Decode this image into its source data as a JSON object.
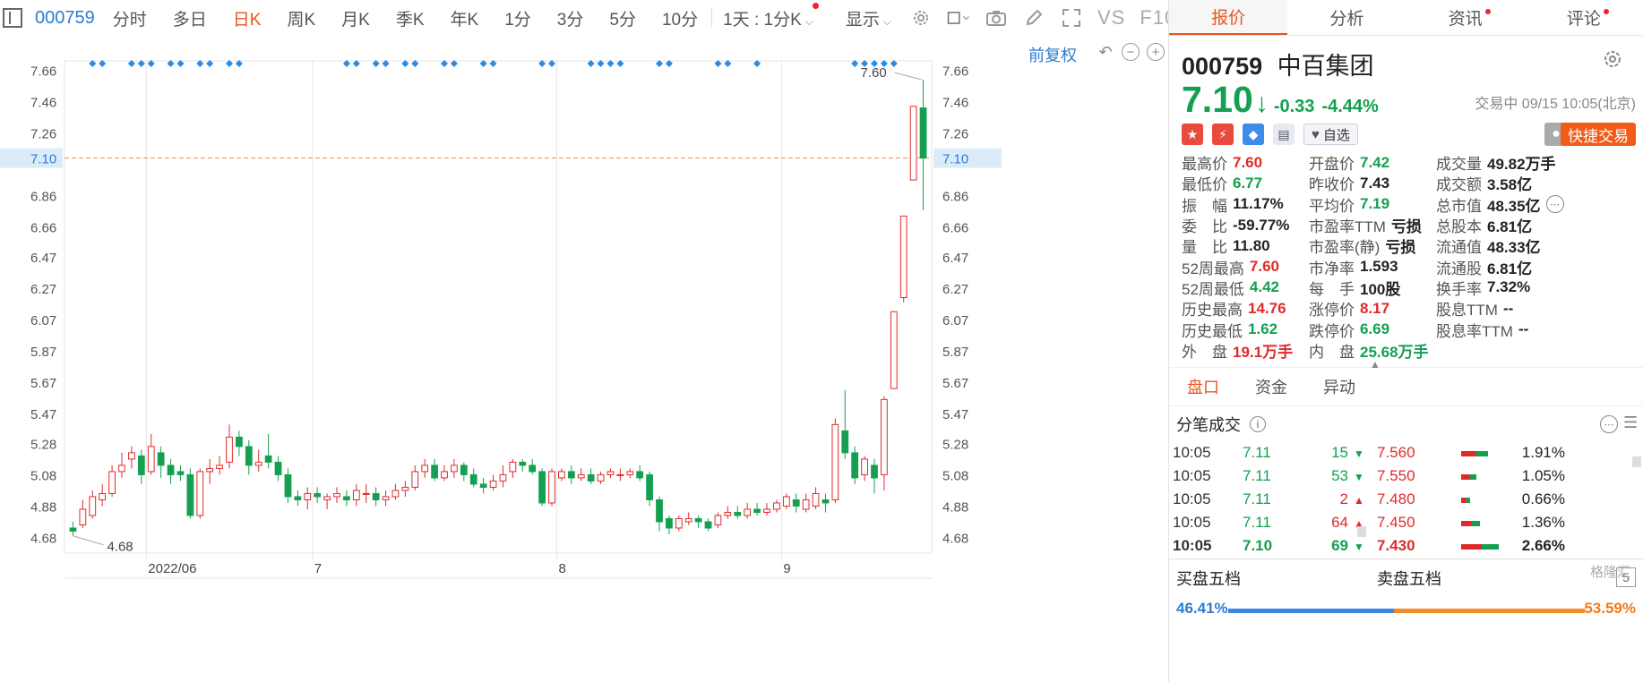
{
  "toolbar": {
    "code": "000759",
    "periods": [
      "分时",
      "多日",
      "日K",
      "周K",
      "月K",
      "季K",
      "年K",
      "1分",
      "3分",
      "5分",
      "10分"
    ],
    "active_period": "日K",
    "interval_select": "1天 : 1分K",
    "display_label": "显示",
    "vs_label": "VS",
    "f10_label": "F10"
  },
  "chart": {
    "adjust_label": "前复权",
    "y_ticks": [
      "7.66",
      "7.46",
      "7.26",
      "7.10",
      "6.86",
      "6.66",
      "6.47",
      "6.27",
      "6.07",
      "5.87",
      "5.67",
      "5.47",
      "5.28",
      "5.08",
      "4.88",
      "4.68"
    ],
    "current_price_label": "7.10",
    "high_label": "7.60",
    "low_label": "4.68",
    "x_labels": [
      "2022/06",
      "7",
      "8",
      "9"
    ],
    "up_color": "#e02a2a",
    "down_color": "#14a050"
  },
  "chart_data": {
    "type": "candlestick",
    "ylim": [
      4.58,
      7.72
    ],
    "current_price": 7.1,
    "high_marker": 7.6,
    "low_marker": 4.68,
    "month_boundaries": [
      {
        "label": "2022/06",
        "index": 8
      },
      {
        "label": "7",
        "index": 25
      },
      {
        "label": "8",
        "index": 50
      },
      {
        "label": "9",
        "index": 73
      }
    ],
    "event_marker_indices": [
      2,
      3,
      6,
      7,
      8,
      10,
      11,
      13,
      14,
      16,
      17,
      28,
      29,
      31,
      32,
      34,
      35,
      38,
      39,
      42,
      43,
      48,
      49,
      53,
      54,
      55,
      56,
      60,
      61,
      66,
      67,
      70,
      80,
      81,
      82,
      83,
      84
    ],
    "ohlc": [
      [
        4.74,
        4.72,
        4.78,
        4.69
      ],
      [
        4.76,
        4.86,
        4.92,
        4.74
      ],
      [
        4.82,
        4.94,
        4.98,
        4.8
      ],
      [
        4.92,
        4.96,
        5.02,
        4.88
      ],
      [
        4.96,
        5.1,
        5.14,
        4.94
      ],
      [
        5.1,
        5.14,
        5.22,
        5.06
      ],
      [
        5.18,
        5.22,
        5.26,
        5.12
      ],
      [
        5.2,
        5.08,
        5.24,
        5.02
      ],
      [
        5.1,
        5.26,
        5.34,
        5.08
      ],
      [
        5.22,
        5.14,
        5.26,
        5.06
      ],
      [
        5.14,
        5.08,
        5.18,
        5.02
      ],
      [
        5.1,
        5.08,
        5.14,
        5.04
      ],
      [
        5.08,
        4.82,
        5.12,
        4.8
      ],
      [
        4.82,
        5.1,
        5.12,
        4.8
      ],
      [
        5.1,
        5.12,
        5.18,
        5.02
      ],
      [
        5.12,
        5.14,
        5.2,
        5.08
      ],
      [
        5.16,
        5.32,
        5.4,
        5.12
      ],
      [
        5.32,
        5.26,
        5.36,
        5.2
      ],
      [
        5.26,
        5.14,
        5.3,
        5.08
      ],
      [
        5.14,
        5.16,
        5.24,
        5.1
      ],
      [
        5.2,
        5.16,
        5.34,
        5.12
      ],
      [
        5.16,
        5.08,
        5.2,
        5.04
      ],
      [
        5.08,
        4.94,
        5.12,
        4.9
      ],
      [
        4.94,
        4.92,
        4.98,
        4.88
      ],
      [
        4.92,
        4.96,
        5.0,
        4.86
      ],
      [
        4.96,
        4.94,
        5.0,
        4.9
      ],
      [
        4.92,
        4.94,
        4.96,
        4.86
      ],
      [
        4.94,
        4.96,
        5.0,
        4.9
      ],
      [
        4.94,
        4.92,
        4.98,
        4.88
      ],
      [
        4.92,
        4.98,
        5.02,
        4.88
      ],
      [
        4.96,
        4.96,
        5.02,
        4.9
      ],
      [
        4.96,
        4.92,
        5.0,
        4.88
      ],
      [
        4.92,
        4.94,
        4.98,
        4.88
      ],
      [
        4.94,
        4.98,
        5.02,
        4.92
      ],
      [
        4.98,
        5.0,
        5.04,
        4.94
      ],
      [
        5.0,
        5.1,
        5.14,
        4.98
      ],
      [
        5.1,
        5.14,
        5.18,
        5.06
      ],
      [
        5.14,
        5.06,
        5.18,
        5.04
      ],
      [
        5.06,
        5.1,
        5.14,
        5.04
      ],
      [
        5.1,
        5.14,
        5.18,
        5.06
      ],
      [
        5.14,
        5.08,
        5.16,
        5.04
      ],
      [
        5.08,
        5.02,
        5.12,
        5.0
      ],
      [
        5.02,
        5.0,
        5.06,
        4.96
      ],
      [
        5.0,
        5.04,
        5.08,
        4.98
      ],
      [
        5.04,
        5.08,
        5.14,
        5.0
      ],
      [
        5.1,
        5.16,
        5.18,
        5.06
      ],
      [
        5.16,
        5.14,
        5.18,
        5.1
      ],
      [
        5.14,
        5.1,
        5.18,
        5.08
      ],
      [
        5.1,
        4.9,
        5.12,
        4.88
      ],
      [
        4.9,
        5.1,
        5.12,
        4.88
      ],
      [
        5.06,
        5.1,
        5.12,
        5.04
      ],
      [
        5.1,
        5.06,
        5.14,
        5.02
      ],
      [
        5.06,
        5.08,
        5.12,
        5.04
      ],
      [
        5.08,
        5.04,
        5.12,
        5.02
      ],
      [
        5.04,
        5.08,
        5.1,
        5.02
      ],
      [
        5.08,
        5.1,
        5.12,
        5.06
      ],
      [
        5.08,
        5.08,
        5.12,
        5.04
      ],
      [
        5.08,
        5.1,
        5.12,
        5.06
      ],
      [
        5.1,
        5.06,
        5.14,
        5.04
      ],
      [
        5.08,
        4.92,
        5.1,
        4.88
      ],
      [
        4.92,
        4.78,
        4.94,
        4.72
      ],
      [
        4.8,
        4.74,
        4.82,
        4.7
      ],
      [
        4.74,
        4.8,
        4.82,
        4.72
      ],
      [
        4.78,
        4.8,
        4.84,
        4.76
      ],
      [
        4.8,
        4.78,
        4.82,
        4.74
      ],
      [
        4.78,
        4.74,
        4.8,
        4.72
      ],
      [
        4.76,
        4.82,
        4.84,
        4.74
      ],
      [
        4.82,
        4.84,
        4.88,
        4.8
      ],
      [
        4.84,
        4.82,
        4.88,
        4.8
      ],
      [
        4.82,
        4.86,
        4.9,
        4.8
      ],
      [
        4.86,
        4.84,
        4.9,
        4.82
      ],
      [
        4.84,
        4.86,
        4.9,
        4.82
      ],
      [
        4.86,
        4.9,
        4.92,
        4.84
      ],
      [
        4.88,
        4.94,
        4.96,
        4.86
      ],
      [
        4.92,
        4.88,
        4.96,
        4.84
      ],
      [
        4.86,
        4.92,
        4.96,
        4.84
      ],
      [
        4.88,
        4.96,
        5.0,
        4.86
      ],
      [
        4.92,
        4.9,
        4.96,
        4.84
      ],
      [
        4.92,
        5.4,
        5.44,
        4.9
      ],
      [
        5.36,
        5.22,
        5.62,
        5.18
      ],
      [
        5.22,
        5.06,
        5.26,
        5.02
      ],
      [
        5.08,
        5.18,
        5.2,
        5.04
      ],
      [
        5.14,
        5.06,
        5.18,
        4.96
      ],
      [
        5.08,
        5.56,
        5.58,
        4.98
      ],
      [
        5.63,
        6.12,
        6.12,
        5.63
      ],
      [
        6.21,
        6.73,
        6.73,
        6.18
      ],
      [
        6.96,
        7.43,
        7.43,
        6.96
      ],
      [
        7.42,
        7.1,
        7.6,
        6.77
      ]
    ]
  },
  "panel": {
    "tabs": [
      "报价",
      "分析",
      "资讯",
      "评论"
    ],
    "active_tab": "报价",
    "code": "000759",
    "name": "中百集团",
    "price": "7.10",
    "change": "-0.33",
    "change_pct": "-4.44%",
    "status": "交易中 09/15 10:05(北京)",
    "favorite_label": "自选",
    "quick_trade_label": "快捷交易",
    "quote": {
      "col1": [
        {
          "label": "最高价",
          "value": "7.60",
          "tone": "red"
        },
        {
          "label": "最低价",
          "value": "6.77",
          "tone": "green"
        },
        {
          "label": "振　幅",
          "value": "11.17%",
          "tone": "dark"
        },
        {
          "label": "委　比",
          "value": "-59.77%",
          "tone": "dark"
        },
        {
          "label": "量　比",
          "value": "11.80",
          "tone": "dark"
        },
        {
          "label": "52周最高",
          "value": "7.60",
          "tone": "red"
        },
        {
          "label": "52周最低",
          "value": "4.42",
          "tone": "green"
        },
        {
          "label": "历史最高",
          "value": "14.76",
          "tone": "red"
        },
        {
          "label": "历史最低",
          "value": "1.62",
          "tone": "green"
        },
        {
          "label": "外　盘",
          "value": "19.1万手",
          "tone": "red"
        }
      ],
      "col2": [
        {
          "label": "开盘价",
          "value": "7.42",
          "tone": "green"
        },
        {
          "label": "昨收价",
          "value": "7.43",
          "tone": "dark"
        },
        {
          "label": "平均价",
          "value": "7.19",
          "tone": "green"
        },
        {
          "label": "市盈率TTM",
          "value": "亏损",
          "tone": "dark"
        },
        {
          "label": "市盈率(静)",
          "value": "亏损",
          "tone": "dark"
        },
        {
          "label": "市净率",
          "value": "1.593",
          "tone": "dark"
        },
        {
          "label": "每　手",
          "value": "100股",
          "tone": "dark"
        },
        {
          "label": "涨停价",
          "value": "8.17",
          "tone": "red"
        },
        {
          "label": "跌停价",
          "value": "6.69",
          "tone": "green"
        },
        {
          "label": "内　盘",
          "value": "25.68万手",
          "tone": "green"
        }
      ],
      "col3": [
        {
          "label": "成交量",
          "value": "49.82万手",
          "tone": "dark"
        },
        {
          "label": "成交额",
          "value": "3.58亿",
          "tone": "dark"
        },
        {
          "label": "总市值",
          "value": "48.35亿",
          "tone": "dark"
        },
        {
          "label": "总股本",
          "value": "6.81亿",
          "tone": "dark"
        },
        {
          "label": "流通值",
          "value": "48.33亿",
          "tone": "dark"
        },
        {
          "label": "流通股",
          "value": "6.81亿",
          "tone": "dark"
        },
        {
          "label": "换手率",
          "value": "7.32%",
          "tone": "dark"
        },
        {
          "label": "股息TTM",
          "value": "--",
          "tone": "dark"
        },
        {
          "label": "股息率TTM",
          "value": "--",
          "tone": "dark"
        }
      ]
    },
    "subtabs": [
      "盘口",
      "资金",
      "异动"
    ],
    "active_subtab": "盘口",
    "ticks_title": "分笔成交",
    "ticks": [
      {
        "time": "10:05",
        "price": "7.11",
        "vol": "15",
        "dir": "down"
      },
      {
        "time": "10:05",
        "price": "7.11",
        "vol": "53",
        "dir": "down"
      },
      {
        "time": "10:05",
        "price": "7.11",
        "vol": "2",
        "dir": "up"
      },
      {
        "time": "10:05",
        "price": "7.11",
        "vol": "64",
        "dir": "up"
      },
      {
        "time": "10:05",
        "price": "7.10",
        "vol": "69",
        "dir": "down"
      }
    ],
    "levels": [
      {
        "price": "7.560",
        "pct": "1.91%",
        "share": 1.91
      },
      {
        "price": "7.550",
        "pct": "1.05%",
        "share": 1.05
      },
      {
        "price": "7.480",
        "pct": "0.66%",
        "share": 0.66
      },
      {
        "price": "7.450",
        "pct": "1.36%",
        "share": 1.36
      },
      {
        "price": "7.430",
        "pct": "2.66%",
        "share": 2.66
      }
    ],
    "book_buy_label": "买盘五档",
    "book_sell_label": "卖盘五档",
    "book_depth": "5",
    "buy_ratio": "46.41%",
    "sell_ratio": "53.59%",
    "buy_ratio_value": 46.41,
    "watermark": "格隆汇"
  }
}
